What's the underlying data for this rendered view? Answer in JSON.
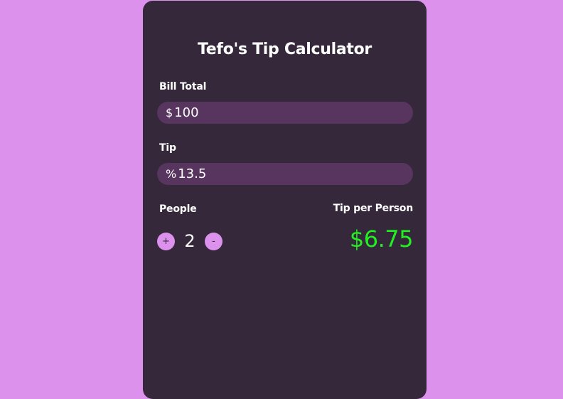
{
  "app": {
    "title": "Tefo's Tip Calculator"
  },
  "bill": {
    "label": "Bill Total",
    "prefix": "$",
    "value": "100"
  },
  "tip": {
    "label": "Tip",
    "prefix": "%",
    "value": "13.5"
  },
  "people": {
    "label": "People",
    "count": "2",
    "increment_label": "+",
    "decrement_label": "-"
  },
  "result": {
    "label": "Tip per Person",
    "value": "$6.75"
  },
  "colors": {
    "background": "#dc91ec",
    "card": "#35283a",
    "input": "#58355f",
    "accent": "#dc91ec",
    "result": "#21f021"
  }
}
